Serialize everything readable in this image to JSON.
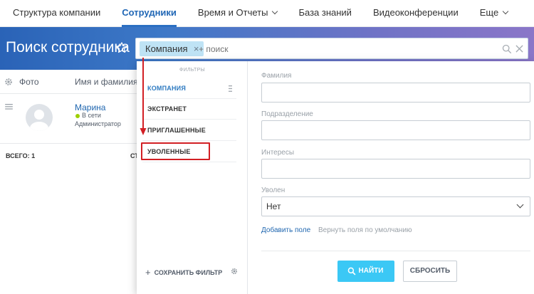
{
  "topnav": {
    "items": [
      {
        "label": "Структура компании",
        "active": false,
        "has_chevron": false
      },
      {
        "label": "Сотрудники",
        "active": true,
        "has_chevron": false
      },
      {
        "label": "Время и Отчеты",
        "active": false,
        "has_chevron": true
      },
      {
        "label": "База знаний",
        "active": false,
        "has_chevron": false
      },
      {
        "label": "Видеоконференции",
        "active": false,
        "has_chevron": false
      },
      {
        "label": "Еще",
        "active": false,
        "has_chevron": true
      }
    ]
  },
  "page": {
    "title": "Поиск сотрудника",
    "star_icon": "star-outline-icon"
  },
  "search": {
    "chip_label": "Компания",
    "chip_close": "×",
    "placeholder": "+ поиск"
  },
  "grid": {
    "columns": {
      "photo": "Фото",
      "name": "Имя и фамилия"
    },
    "rows": [
      {
        "name": "Марина",
        "status": "В сети",
        "role": "Администратор"
      }
    ],
    "footer_total": "ВСЕГО: 1",
    "footer_cut": "СТ"
  },
  "filter": {
    "presets_title": "ФИЛЬТРЫ",
    "presets": [
      {
        "label": "КОМПАНИЯ",
        "active": true
      },
      {
        "label": "ЭКСТРАНЕТ",
        "active": false
      },
      {
        "label": "ПРИГЛАШЕННЫЕ",
        "active": false
      },
      {
        "label": "УВОЛЕННЫЕ",
        "active": false
      }
    ],
    "save_filter": "СОХРАНИТЬ ФИЛЬТР",
    "fields": {
      "lastname_label": "Фамилия",
      "department_label": "Подразделение",
      "interests_label": "Интересы",
      "fired_label": "Уволен",
      "fired_value": "Нет"
    },
    "add_field": "Добавить поле",
    "reset_fields": "Вернуть поля по умолчанию",
    "find_button": "НАЙТИ",
    "reset_button": "СБРОСИТЬ"
  },
  "colors": {
    "accent": "#2b6fc2",
    "find_button": "#3bc8f5",
    "highlight": "#d21f24",
    "online": "#9dcf00"
  }
}
